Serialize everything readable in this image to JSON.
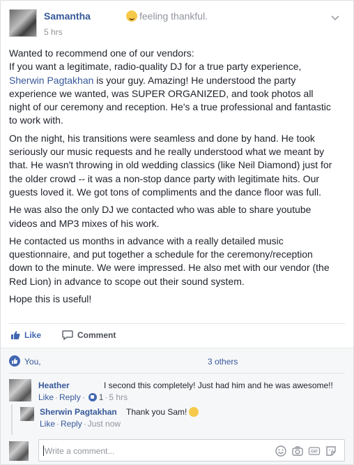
{
  "post": {
    "author": "Samantha",
    "feeling": "feeling thankful.",
    "time": "5 hrs",
    "paragraphs": [
      {
        "before": "Wanted to recommend one of our vendors:\nIf you want a legitimate, radio-quality DJ for a true party experience, ",
        "mention": "Sherwin Pagtakhan",
        "after": " is your guy. Amazing! He understood the party experience we wanted, was SUPER ORGANIZED, and took photos all night of our ceremony and reception. He's a true professional and fantastic to work with."
      },
      {
        "text": "On the night, his transitions were seamless and done by hand. He took seriously our music requests and he really understood what we meant by that. He wasn't throwing in old wedding classics (like Neil Diamond) just for the older crowd -- it was a non-stop dance party with legitimate hits. Our guests loved it. We got tons of compliments and the dance floor was full."
      },
      {
        "text": "He was also the only DJ we contacted who was able to share youtube videos and MP3 mixes of his work."
      },
      {
        "text": "He contacted us months in advance with a really detailed music questionnaire, and put together a schedule for the ceremony/reception down to the minute. We were impressed. He also met with our vendor (the Red Lion) in advance to scope out their sound system."
      },
      {
        "text": "Hope this is useful!"
      }
    ]
  },
  "actions": {
    "like_label": "Like",
    "comment_label": "Comment"
  },
  "likes": {
    "you": "You,",
    "others": "3 others"
  },
  "comments": [
    {
      "author": "Heather",
      "text": "I second this completely! Just had him and he was awesome!!",
      "like": "Like",
      "reply": "Reply",
      "like_count": "1",
      "time": "5 hrs"
    }
  ],
  "reply": {
    "author": "Sherwin Pagtakhan",
    "text": "Thank you Sam!",
    "like": "Like",
    "reply": "Reply",
    "time": "Just now"
  },
  "composer": {
    "placeholder": "Write a comment..."
  },
  "icons": [
    "chevron-down-icon",
    "like-icon",
    "comment-icon",
    "emoji-icon",
    "camera-icon",
    "gif-icon",
    "sticker-icon"
  ],
  "colors": {
    "link": "#365899",
    "like_blue": "#4267b2",
    "text": "#1d2129",
    "muted": "#90949c"
  }
}
